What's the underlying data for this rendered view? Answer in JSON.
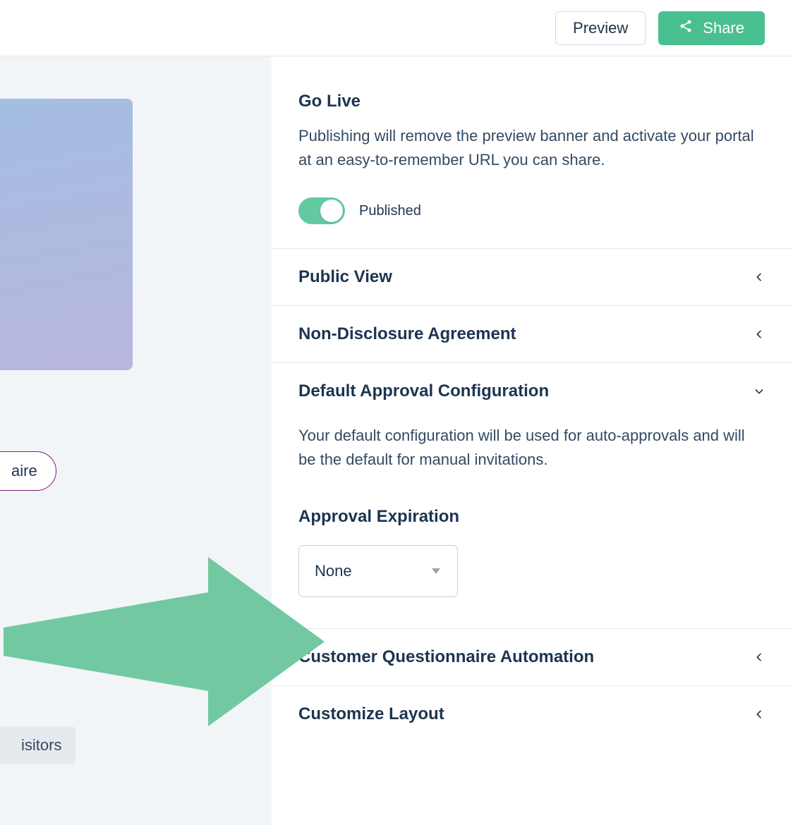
{
  "topbar": {
    "preview_label": "Preview",
    "share_label": "Share"
  },
  "left": {
    "chip_label": "aire",
    "tag_label": "isitors"
  },
  "go_live": {
    "title": "Go Live",
    "description": "Publishing will remove the preview banner and activate your portal at an easy-to-remember URL you can share.",
    "toggle_label": "Published"
  },
  "rows": {
    "public_view": "Public View",
    "nda": "Non-Disclosure Agreement",
    "dac": "Default Approval Configuration",
    "cqa": "Customer Questionnaire Automation",
    "customize_layout": "Customize Layout"
  },
  "dac": {
    "description": "Your default configuration will be used for auto-approvals and will be the default for manual invitations.",
    "approval_expiration_label": "Approval Expiration",
    "approval_expiration_value": "None"
  }
}
